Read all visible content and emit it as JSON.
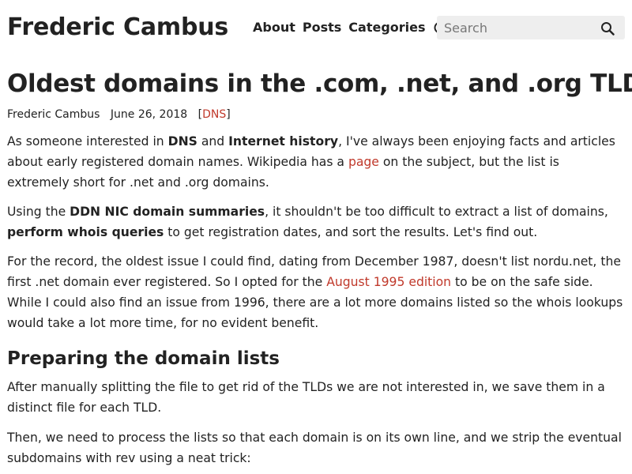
{
  "header": {
    "site_title": "Frederic Cambus",
    "nav": [
      "About",
      "Posts",
      "Categories"
    ],
    "theme_toggle_icon": "half-circle-contrast-icon",
    "search": {
      "placeholder": "Search",
      "icon": "search-icon"
    }
  },
  "post": {
    "title": "Oldest domains in the .com, .net, and .org TLDs",
    "author": "Frederic Cambus",
    "date": "June 26, 2018",
    "category_open": "[",
    "category": "DNS",
    "category_close": "]",
    "p1": {
      "t1": "As someone interested in ",
      "b1": "DNS",
      "t2": " and ",
      "b2": "Internet history",
      "t3": ", I've always been enjoying facts and articles about early registered domain names. Wikipedia has a ",
      "link": "page",
      "t4": " on the subject, but the list is extremely short for .net and .org domains."
    },
    "p2": {
      "t1": "Using the ",
      "b1": "DDN NIC domain summaries",
      "t2": ", it shouldn't be too difficult to extract a list of domains, ",
      "b2": "perform whois queries",
      "t3": " to get registration dates, and sort the results. Let's find out."
    },
    "p3": {
      "t1": "For the record, the oldest issue I could find, dating from December 1987, doesn't list nordu.net, the first .net domain ever registered. So I opted for the ",
      "link": "August 1995 edition",
      "t2": " to be on the safe side. While I could also find an issue from 1996, there are a lot more domains listed so the whois lookups would take a lot more time, for no evident benefit."
    },
    "h2": "Preparing the domain lists",
    "p4": "After manually splitting the file to get rid of the TLDs we are not interested in, we save them in a distinct file for each TLD.",
    "p5": "Then, we need to process the lists so that each domain is on its own line, and we strip the eventual subdomains with rev using a neat trick:"
  },
  "colors": {
    "link": "#c0392b",
    "text": "#222222",
    "search_bg": "#eeeeee"
  }
}
